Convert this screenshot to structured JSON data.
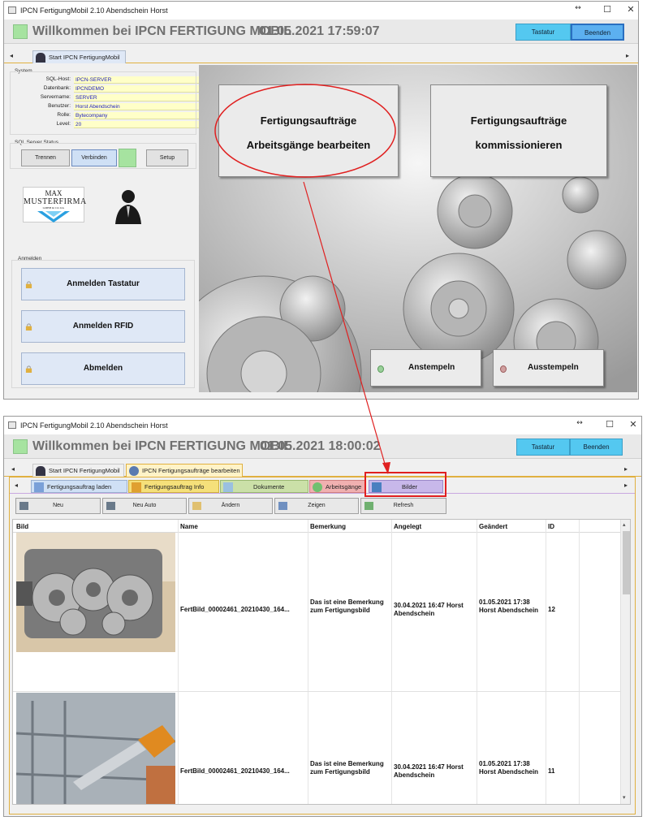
{
  "window_top": {
    "title": "IPCN FertigungMobil 2.10  Abendschein Horst",
    "welcome": "Willkommen bei IPCN FERTIGUNG MOBIL",
    "datetime": "01.05.2021  17:59:07",
    "btn_tastatur": "Tastatur",
    "btn_beenden": "Beenden",
    "tab_start": "Start IPCN FertigungMobil",
    "system": {
      "group": "System",
      "fields": [
        {
          "label": "SQL-Host:",
          "value": "IPCN-SERVER"
        },
        {
          "label": "Datenbank:",
          "value": "IPCNDEMO"
        },
        {
          "label": "Servername:",
          "value": "SERVER"
        },
        {
          "label": "Benutzer:",
          "value": "Horst Abendschein"
        },
        {
          "label": "Rolle:",
          "value": "Bytecompany"
        },
        {
          "label": "Level:",
          "value": "20"
        }
      ]
    },
    "sql_status": {
      "group": "SQL Server Status",
      "btn_trennen": "Trennen",
      "btn_verbinden": "Verbinden",
      "btn_setup": "Setup"
    },
    "logo": {
      "line1": "MAX",
      "line2": "MUSTERFIRMA",
      "line3": "GMBH & CO. KG"
    },
    "anmelden": {
      "group": "Anmelden",
      "btn_tastatur": "Anmelden Tastatur",
      "btn_rfid": "Anmelden RFID",
      "btn_abmelden": "Abmelden"
    },
    "tile1": {
      "line1": "Fertigungsaufträge",
      "line2": "Arbeitsgänge bearbeiten"
    },
    "tile2": {
      "line1": "Fertigungsaufträge",
      "line2": "kommissionieren"
    },
    "btn_anstempeln": "Anstempeln",
    "btn_ausstempeln": "Ausstempeln"
  },
  "window_bottom": {
    "title": "IPCN FertigungMobil 2.10  Abendschein Horst",
    "welcome": "Willkommen bei IPCN FERTIGUNG MOBIL",
    "datetime": "01.05.2021  18:00:02",
    "btn_tastatur": "Tastatur",
    "btn_beenden": "Beenden",
    "tab_start": "Start IPCN FertigungMobil",
    "tab_fa": "IPCN Fertigungsaufträge bearbeiten",
    "subtabs": [
      "Fertigungsauftrag laden",
      "Fertigungsauftrag Info",
      "Dokumente",
      "Arbeitsgänge",
      "Bilder"
    ],
    "toolbar": [
      "Neu",
      "Neu Auto",
      "Ändern",
      "Zeigen",
      "Refresh"
    ],
    "columns": [
      "Bild",
      "Name",
      "Bemerkung",
      "Angelegt",
      "Geändert",
      "ID"
    ],
    "rows": [
      {
        "name": "FertBild_00002461_20210430_164...",
        "bemerkung": "Das ist eine Bemerkung zum Fertigungsbild",
        "angelegt": "30.04.2021 16:47 Horst Abendschein",
        "geaendert": "01.05.2021 17:38 Horst Abendschein",
        "id": "12"
      },
      {
        "name": "FertBild_00002461_20210430_164...",
        "bemerkung": "Das ist eine Bemerkung zum Fertigungsbild",
        "angelegt": "30.04.2021 16:47 Horst Abendschein",
        "geaendert": "01.05.2021 17:38 Horst Abendschein",
        "id": "11"
      }
    ]
  },
  "colors": {
    "accent_blue": "#54c8f0",
    "highlight_red": "#e02020",
    "status_green": "#a6e3a0"
  }
}
